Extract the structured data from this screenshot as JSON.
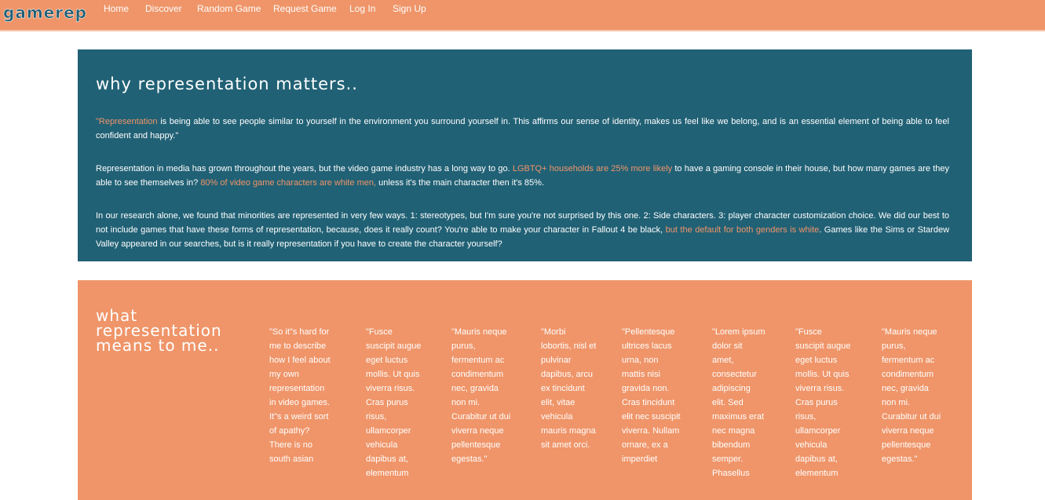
{
  "brand": {
    "logo": "GameRep"
  },
  "nav": {
    "items": [
      {
        "label": "Home"
      },
      {
        "label": "Discover"
      },
      {
        "label": "Random Game"
      },
      {
        "label": "Request Game"
      },
      {
        "label": "Log In"
      },
      {
        "label": "Sign Up"
      }
    ]
  },
  "why": {
    "title": "Why Representation Matters..",
    "p1": {
      "link": "\"Representation",
      "text": " is being able to see people similar to yourself in the environment you surround yourself in. This affirms our sense of identity, makes us feel like we belong, and is an essential element of being able to feel confident and happy.\""
    },
    "p2": {
      "text1": "Representation in media has grown throughout the years, but the video game industry has a long way to go. ",
      "link1": "LGBTQ+ households are 25% more likely",
      "text2": " to have a gaming console in their house, but how many games are they able to see themselves in? ",
      "link2": "80% of video game characters are white men,",
      "text3": " unless it's the main character then it's 85%."
    },
    "p3": {
      "text1": "In our research alone, we found that minorities are represented in very few ways. 1: stereotypes, but I'm sure you're not surprised by this one. 2: Side characters. 3: player character customization choice. We did our best to not include games that have these forms of representation, because, does it really count? You're able to make your character in Fallout 4 be black, ",
      "link1": "but the default for both genders is white",
      "text2": ". Games like the Sims or Stardew Valley appeared in our searches, but is it really representation if you have to create the character yourself?"
    }
  },
  "means": {
    "title": "What Representation Means To Me..",
    "quotes": [
      "\"So it\"s hard for me to describe how I feel about my own representation in video games. It\"s a weird sort of apathy? There is no south asian",
      "\"Fusce suscipit augue eget luctus mollis. Ut quis viverra risus. Cras purus risus, ullamcorper vehicula dapibus at, elementum",
      "\"Mauris neque purus, fermentum ac condimentum nec, gravida non mi. Curabitur ut dui viverra neque pellentesque egestas.\"",
      "\"Morbi lobortis, nisl et pulvinar dapibus, arcu ex tincidunt elit, vitae vehicula mauris magna sit amet orci.",
      "\"Pellentesque ultrices lacus urna, non mattis nisi gravida non. Cras tincidunt elit nec suscipit viverra. Nullam ornare, ex a imperdiet",
      "\"Lorem ipsum dolor sit amet, consectetur adipiscing elit. Sed maximus erat nec magna bibendum semper. Phasellus",
      "\"Fusce suscipit augue eget luctus mollis. Ut quis viverra risus. Cras purus risus, ullamcorper vehicula dapibus at, elementum",
      "\"Mauris neque purus, fermentum ac condimentum nec, gravida non mi. Curabitur ut dui viverra neque pellentesque egestas.\""
    ]
  },
  "colors": {
    "nav_bg": "#ef9569",
    "teal_bg": "#216175",
    "orange_bg": "#ef9569",
    "link": "#ef9569",
    "text": "#ffffff"
  }
}
